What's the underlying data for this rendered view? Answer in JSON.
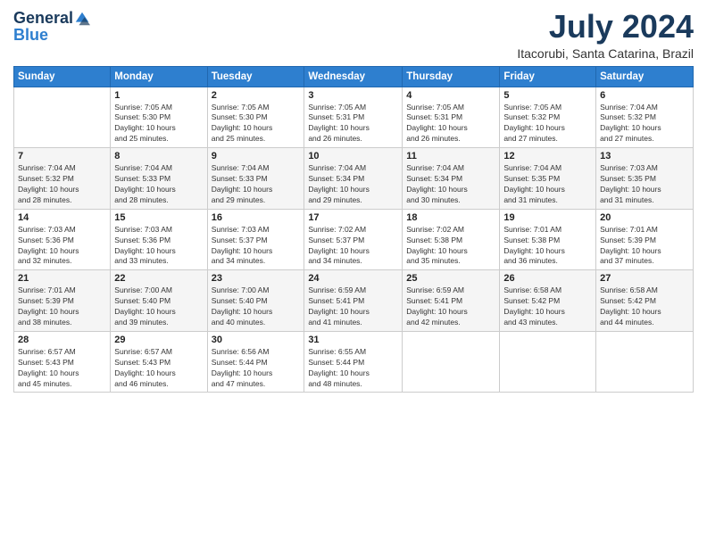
{
  "logo": {
    "general": "General",
    "blue": "Blue"
  },
  "title": {
    "month_year": "July 2024",
    "location": "Itacorubi, Santa Catarina, Brazil"
  },
  "days_of_week": [
    "Sunday",
    "Monday",
    "Tuesday",
    "Wednesday",
    "Thursday",
    "Friday",
    "Saturday"
  ],
  "weeks": [
    [
      {
        "day": "",
        "info": ""
      },
      {
        "day": "1",
        "info": "Sunrise: 7:05 AM\nSunset: 5:30 PM\nDaylight: 10 hours\nand 25 minutes."
      },
      {
        "day": "2",
        "info": "Sunrise: 7:05 AM\nSunset: 5:30 PM\nDaylight: 10 hours\nand 25 minutes."
      },
      {
        "day": "3",
        "info": "Sunrise: 7:05 AM\nSunset: 5:31 PM\nDaylight: 10 hours\nand 26 minutes."
      },
      {
        "day": "4",
        "info": "Sunrise: 7:05 AM\nSunset: 5:31 PM\nDaylight: 10 hours\nand 26 minutes."
      },
      {
        "day": "5",
        "info": "Sunrise: 7:05 AM\nSunset: 5:32 PM\nDaylight: 10 hours\nand 27 minutes."
      },
      {
        "day": "6",
        "info": "Sunrise: 7:04 AM\nSunset: 5:32 PM\nDaylight: 10 hours\nand 27 minutes."
      }
    ],
    [
      {
        "day": "7",
        "info": "Sunrise: 7:04 AM\nSunset: 5:32 PM\nDaylight: 10 hours\nand 28 minutes."
      },
      {
        "day": "8",
        "info": "Sunrise: 7:04 AM\nSunset: 5:33 PM\nDaylight: 10 hours\nand 28 minutes."
      },
      {
        "day": "9",
        "info": "Sunrise: 7:04 AM\nSunset: 5:33 PM\nDaylight: 10 hours\nand 29 minutes."
      },
      {
        "day": "10",
        "info": "Sunrise: 7:04 AM\nSunset: 5:34 PM\nDaylight: 10 hours\nand 29 minutes."
      },
      {
        "day": "11",
        "info": "Sunrise: 7:04 AM\nSunset: 5:34 PM\nDaylight: 10 hours\nand 30 minutes."
      },
      {
        "day": "12",
        "info": "Sunrise: 7:04 AM\nSunset: 5:35 PM\nDaylight: 10 hours\nand 31 minutes."
      },
      {
        "day": "13",
        "info": "Sunrise: 7:03 AM\nSunset: 5:35 PM\nDaylight: 10 hours\nand 31 minutes."
      }
    ],
    [
      {
        "day": "14",
        "info": "Sunrise: 7:03 AM\nSunset: 5:36 PM\nDaylight: 10 hours\nand 32 minutes."
      },
      {
        "day": "15",
        "info": "Sunrise: 7:03 AM\nSunset: 5:36 PM\nDaylight: 10 hours\nand 33 minutes."
      },
      {
        "day": "16",
        "info": "Sunrise: 7:03 AM\nSunset: 5:37 PM\nDaylight: 10 hours\nand 34 minutes."
      },
      {
        "day": "17",
        "info": "Sunrise: 7:02 AM\nSunset: 5:37 PM\nDaylight: 10 hours\nand 34 minutes."
      },
      {
        "day": "18",
        "info": "Sunrise: 7:02 AM\nSunset: 5:38 PM\nDaylight: 10 hours\nand 35 minutes."
      },
      {
        "day": "19",
        "info": "Sunrise: 7:01 AM\nSunset: 5:38 PM\nDaylight: 10 hours\nand 36 minutes."
      },
      {
        "day": "20",
        "info": "Sunrise: 7:01 AM\nSunset: 5:39 PM\nDaylight: 10 hours\nand 37 minutes."
      }
    ],
    [
      {
        "day": "21",
        "info": "Sunrise: 7:01 AM\nSunset: 5:39 PM\nDaylight: 10 hours\nand 38 minutes."
      },
      {
        "day": "22",
        "info": "Sunrise: 7:00 AM\nSunset: 5:40 PM\nDaylight: 10 hours\nand 39 minutes."
      },
      {
        "day": "23",
        "info": "Sunrise: 7:00 AM\nSunset: 5:40 PM\nDaylight: 10 hours\nand 40 minutes."
      },
      {
        "day": "24",
        "info": "Sunrise: 6:59 AM\nSunset: 5:41 PM\nDaylight: 10 hours\nand 41 minutes."
      },
      {
        "day": "25",
        "info": "Sunrise: 6:59 AM\nSunset: 5:41 PM\nDaylight: 10 hours\nand 42 minutes."
      },
      {
        "day": "26",
        "info": "Sunrise: 6:58 AM\nSunset: 5:42 PM\nDaylight: 10 hours\nand 43 minutes."
      },
      {
        "day": "27",
        "info": "Sunrise: 6:58 AM\nSunset: 5:42 PM\nDaylight: 10 hours\nand 44 minutes."
      }
    ],
    [
      {
        "day": "28",
        "info": "Sunrise: 6:57 AM\nSunset: 5:43 PM\nDaylight: 10 hours\nand 45 minutes."
      },
      {
        "day": "29",
        "info": "Sunrise: 6:57 AM\nSunset: 5:43 PM\nDaylight: 10 hours\nand 46 minutes."
      },
      {
        "day": "30",
        "info": "Sunrise: 6:56 AM\nSunset: 5:44 PM\nDaylight: 10 hours\nand 47 minutes."
      },
      {
        "day": "31",
        "info": "Sunrise: 6:55 AM\nSunset: 5:44 PM\nDaylight: 10 hours\nand 48 minutes."
      },
      {
        "day": "",
        "info": ""
      },
      {
        "day": "",
        "info": ""
      },
      {
        "day": "",
        "info": ""
      }
    ]
  ]
}
